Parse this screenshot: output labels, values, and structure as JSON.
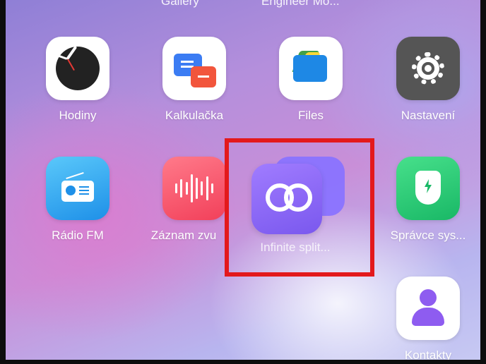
{
  "top_labels": [
    "Gallery",
    "Engineer Mo..."
  ],
  "apps": [
    {
      "label": "Hodiny",
      "icon": "clock-icon"
    },
    {
      "label": "Kalkulačka",
      "icon": "calculator-icon"
    },
    {
      "label": "Files",
      "icon": "files-icon"
    },
    {
      "label": "Nastavení",
      "icon": "settings-gear-icon"
    },
    {
      "label": "Rádio FM",
      "icon": "radio-icon"
    },
    {
      "label": "Záznam zvu",
      "icon": "voice-recorder-icon"
    },
    {
      "label": "Infinite split...",
      "icon": "infinity-loop-icon"
    },
    {
      "label": "Správce sys...",
      "icon": "shield-bolt-icon"
    },
    {
      "label": "Kontakty",
      "icon": "contacts-person-icon"
    }
  ],
  "highlight_color": "#e3191c"
}
